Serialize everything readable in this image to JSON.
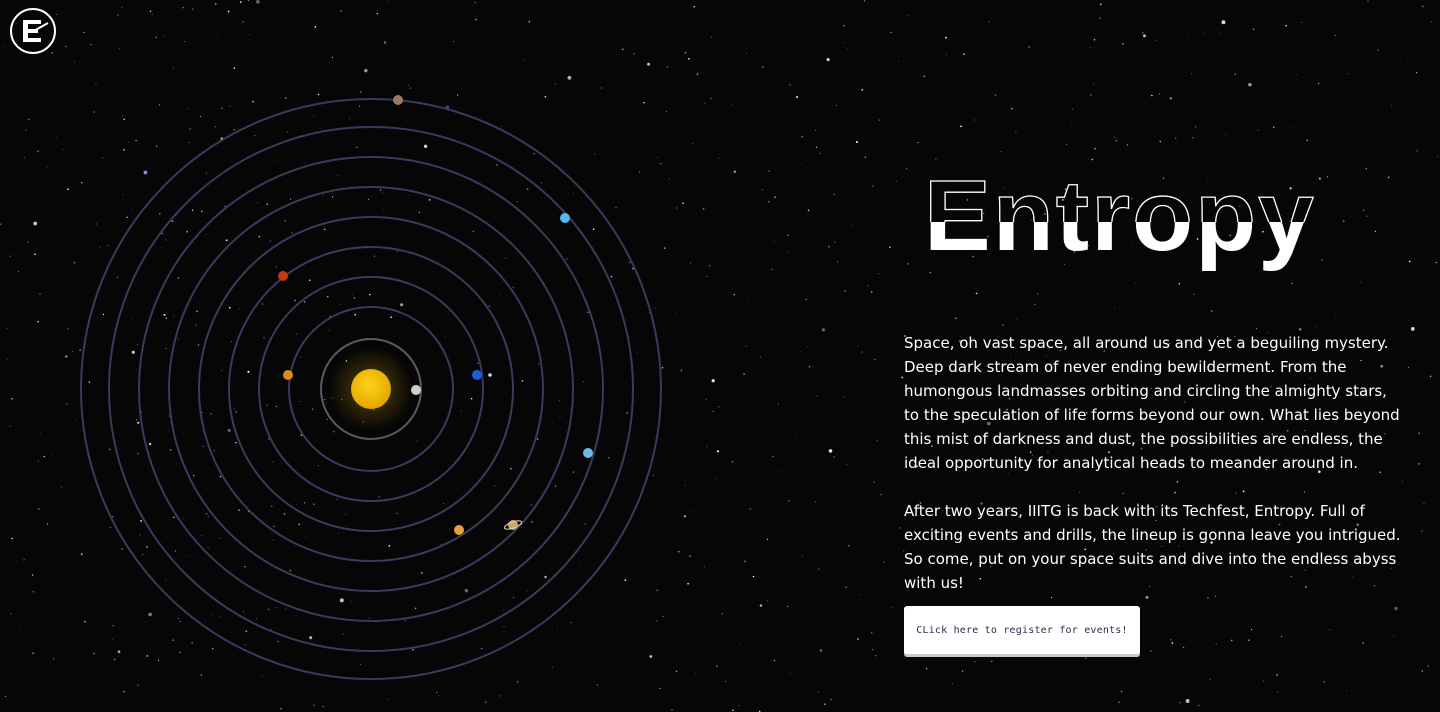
{
  "brand": {
    "logo_icon": "entropy-logo-icon",
    "logo_letter": "E"
  },
  "hero": {
    "title": "Entropy"
  },
  "about": {
    "paragraph_1": "Space, oh vast space, all around us and yet a beguiling mystery. Deep dark stream of never ending bewilderment. From the humongous landmasses orbiting and circling the almighty stars, to the speculation of life forms beyond our own. What lies beyond this mist of darkness and dust, the possibilities are endless, the ideal opportunity for analytical heads to meander around in.",
    "paragraph_2": "After two years, IIITG is back with its Techfest, Entropy. Full of exciting events and drills, the lineup is gonna leave you intrigued. So come, put on your space suits and dive into the endless abyss with us!"
  },
  "cta": {
    "register_label": "CLick here to register for events!"
  },
  "solar_system": {
    "sun_color": "#f2b705",
    "orbit_color": "#3a3b5c",
    "planets": [
      {
        "name": "mercury",
        "color": "#cfcfcf"
      },
      {
        "name": "venus",
        "color": "#d88a1c"
      },
      {
        "name": "earth",
        "color": "#1a5fd6"
      },
      {
        "name": "mars",
        "color": "#c0391b"
      },
      {
        "name": "jupiter",
        "color": "#e8a23a"
      },
      {
        "name": "saturn",
        "color": "#c9a56b"
      },
      {
        "name": "uranus",
        "color": "#6bb9e6"
      },
      {
        "name": "neptune",
        "color": "#55b8f0"
      },
      {
        "name": "pluto",
        "color": "#9a7a66"
      }
    ]
  },
  "colors": {
    "background": "#060606",
    "text": "#ffffff",
    "button_bg": "#ffffff",
    "button_text": "#2c2f4a"
  }
}
